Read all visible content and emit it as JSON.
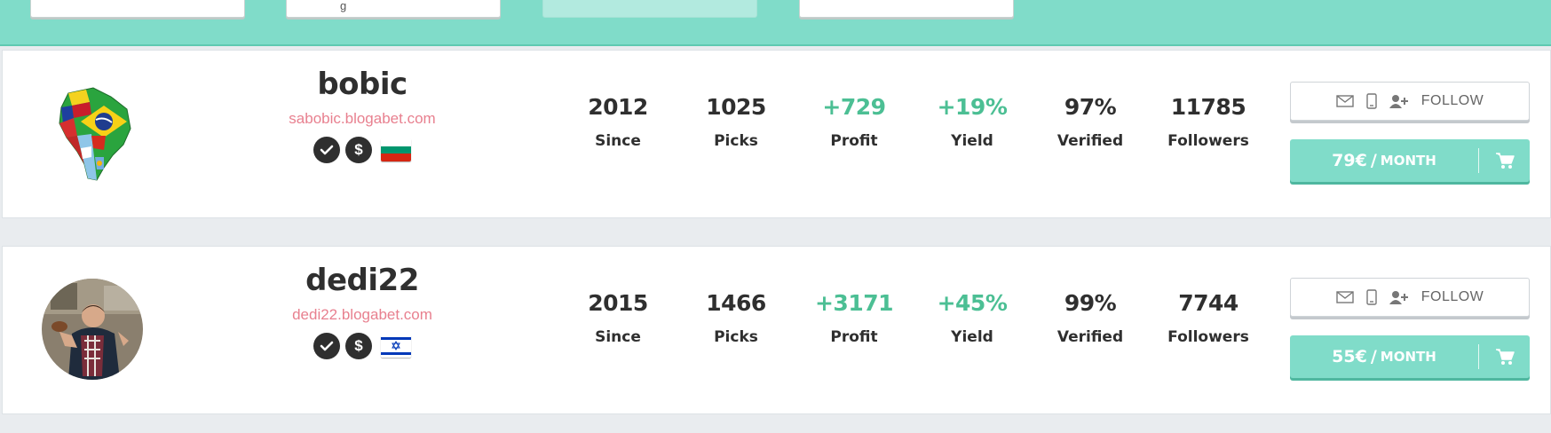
{
  "topbar": {
    "visible_fragment": "g"
  },
  "tipsters": [
    {
      "username": "bobic",
      "blog": "sabobic.blogabet.com",
      "avatar": "south-america-flags-map",
      "flag": "bulgaria",
      "badges": [
        "check-icon",
        "dollar-icon"
      ],
      "stats": {
        "since": "2012",
        "picks": "1025",
        "profit": "+729",
        "yield": "+19%",
        "verified": "97%",
        "followers": "11785"
      },
      "follow_label": "FOLLOW",
      "price": "79€",
      "price_sep": "/",
      "price_period": "MONTH"
    },
    {
      "username": "dedi22",
      "blog": "dedi22.blogabet.com",
      "avatar": "person-photo",
      "flag": "israel",
      "badges": [
        "check-icon",
        "dollar-icon"
      ],
      "stats": {
        "since": "2015",
        "picks": "1466",
        "profit": "+3171",
        "yield": "+45%",
        "verified": "99%",
        "followers": "7744"
      },
      "follow_label": "FOLLOW",
      "price": "55€",
      "price_sep": "/",
      "price_period": "MONTH"
    }
  ],
  "labels": {
    "since": "Since",
    "picks": "Picks",
    "profit": "Profit",
    "yield": "Yield",
    "verified": "Verified",
    "followers": "Followers"
  },
  "colors": {
    "accent": "#80dcc9",
    "positive": "#4cbf94",
    "blog_link": "#e8808f",
    "text": "#2f2f2f"
  }
}
